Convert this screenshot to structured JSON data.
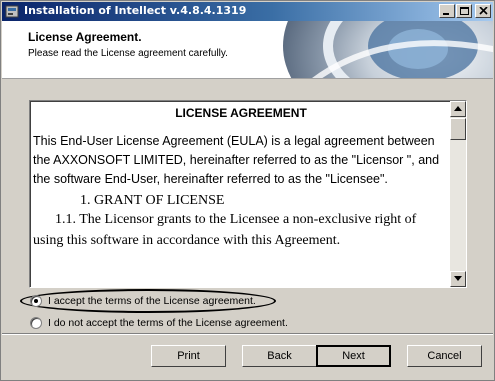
{
  "window": {
    "title": "Installation of Intellect v.4.8.4.1319"
  },
  "header": {
    "title": "License Agreement.",
    "subtitle": "Please read the License agreement carefully."
  },
  "license": {
    "heading": "LICENSE AGREEMENT",
    "paragraph": "This End-User License Agreement (EULA) is a legal agreement between the AXXONSOFT LIMITED, hereinafter referred to as the \"Licensor \", and the software End-User, hereinafter referred to as the \"Licensee\".",
    "grant_title": "1. GRANT OF LICENSE",
    "clause_1_1": "1.1. The Licensor grants to the Licensee a non-exclusive right of using this software in accordance with this Agreement."
  },
  "options": {
    "accept_label": "I accept the terms of the License agreement.",
    "decline_label": "I do not accept the terms of the License agreement.",
    "selected": "accept"
  },
  "buttons": {
    "print": "Print",
    "back": "Back",
    "next": "Next",
    "cancel": "Cancel"
  }
}
